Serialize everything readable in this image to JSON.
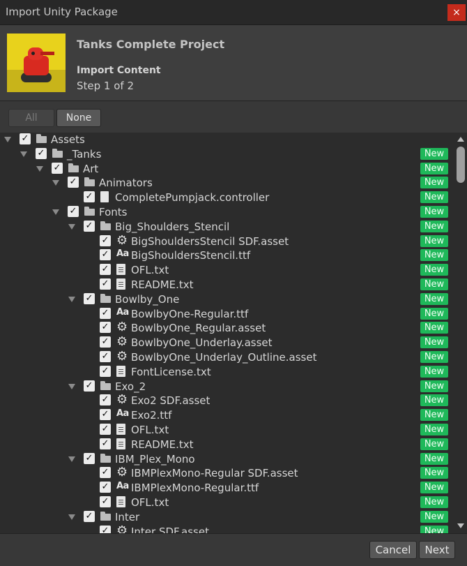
{
  "window": {
    "title": "Import Unity Package",
    "close_glyph": "×"
  },
  "header": {
    "package_name": "Tanks Complete Project",
    "import_title": "Import Content",
    "step": "Step 1 of 2"
  },
  "selection": {
    "all_label": "All",
    "none_label": "None"
  },
  "badge_label": "New",
  "tree": [
    {
      "label": "Assets",
      "level": 0,
      "icon": "folder-icon",
      "expandable": true,
      "checked": true,
      "new": false
    },
    {
      "label": "_Tanks",
      "level": 1,
      "icon": "folder-icon",
      "expandable": true,
      "checked": true,
      "new": true
    },
    {
      "label": "Art",
      "level": 2,
      "icon": "folder-icon",
      "expandable": true,
      "checked": true,
      "new": true
    },
    {
      "label": "Animators",
      "level": 3,
      "icon": "folder-icon",
      "expandable": true,
      "checked": true,
      "new": true
    },
    {
      "label": "CompletePumpjack.controller",
      "level": 4,
      "icon": "file-icon",
      "expandable": false,
      "checked": true,
      "new": true
    },
    {
      "label": "Fonts",
      "level": 3,
      "icon": "folder-icon",
      "expandable": true,
      "checked": true,
      "new": true
    },
    {
      "label": "Big_Shoulders_Stencil",
      "level": 4,
      "icon": "folder-icon",
      "expandable": true,
      "checked": true,
      "new": true
    },
    {
      "label": "BigShouldersStencil SDF.asset",
      "level": 5,
      "icon": "gear-icon",
      "expandable": false,
      "checked": true,
      "new": true
    },
    {
      "label": "BigShouldersStencil.ttf",
      "level": 5,
      "icon": "font-icon",
      "expandable": false,
      "checked": true,
      "new": true
    },
    {
      "label": "OFL.txt",
      "level": 5,
      "icon": "text-file-icon",
      "expandable": false,
      "checked": true,
      "new": true
    },
    {
      "label": "README.txt",
      "level": 5,
      "icon": "text-file-icon",
      "expandable": false,
      "checked": true,
      "new": true
    },
    {
      "label": "Bowlby_One",
      "level": 4,
      "icon": "folder-icon",
      "expandable": true,
      "checked": true,
      "new": true
    },
    {
      "label": "BowlbyOne-Regular.ttf",
      "level": 5,
      "icon": "font-icon",
      "expandable": false,
      "checked": true,
      "new": true
    },
    {
      "label": "BowlbyOne_Regular.asset",
      "level": 5,
      "icon": "gear-icon",
      "expandable": false,
      "checked": true,
      "new": true
    },
    {
      "label": "BowlbyOne_Underlay.asset",
      "level": 5,
      "icon": "gear-icon",
      "expandable": false,
      "checked": true,
      "new": true
    },
    {
      "label": "BowlbyOne_Underlay_Outline.asset",
      "level": 5,
      "icon": "gear-icon",
      "expandable": false,
      "checked": true,
      "new": true
    },
    {
      "label": "FontLicense.txt",
      "level": 5,
      "icon": "text-file-icon",
      "expandable": false,
      "checked": true,
      "new": true
    },
    {
      "label": "Exo_2",
      "level": 4,
      "icon": "folder-icon",
      "expandable": true,
      "checked": true,
      "new": true
    },
    {
      "label": "Exo2 SDF.asset",
      "level": 5,
      "icon": "gear-icon",
      "expandable": false,
      "checked": true,
      "new": true
    },
    {
      "label": "Exo2.ttf",
      "level": 5,
      "icon": "font-icon",
      "expandable": false,
      "checked": true,
      "new": true
    },
    {
      "label": "OFL.txt",
      "level": 5,
      "icon": "text-file-icon",
      "expandable": false,
      "checked": true,
      "new": true
    },
    {
      "label": "README.txt",
      "level": 5,
      "icon": "text-file-icon",
      "expandable": false,
      "checked": true,
      "new": true
    },
    {
      "label": "IBM_Plex_Mono",
      "level": 4,
      "icon": "folder-icon",
      "expandable": true,
      "checked": true,
      "new": true
    },
    {
      "label": "IBMPlexMono-Regular SDF.asset",
      "level": 5,
      "icon": "gear-icon",
      "expandable": false,
      "checked": true,
      "new": true
    },
    {
      "label": "IBMPlexMono-Regular.ttf",
      "level": 5,
      "icon": "font-icon",
      "expandable": false,
      "checked": true,
      "new": true
    },
    {
      "label": "OFL.txt",
      "level": 5,
      "icon": "text-file-icon",
      "expandable": false,
      "checked": true,
      "new": true
    },
    {
      "label": "Inter",
      "level": 4,
      "icon": "folder-icon",
      "expandable": true,
      "checked": true,
      "new": true
    },
    {
      "label": "Inter SDF.asset",
      "level": 5,
      "icon": "gear-icon",
      "expandable": false,
      "checked": true,
      "new": true
    }
  ],
  "footer": {
    "cancel_label": "Cancel",
    "next_label": "Next"
  },
  "colors": {
    "new_badge": "#1fb85a",
    "close_button": "#c42b1c",
    "background": "#383838",
    "tree_background": "#2c2c2c"
  }
}
